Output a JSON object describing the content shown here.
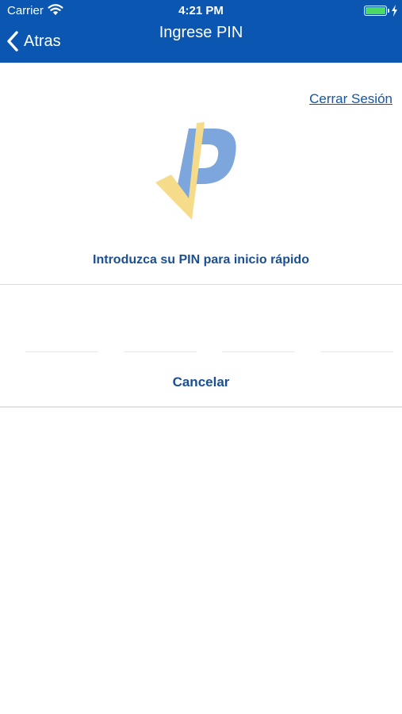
{
  "status_bar": {
    "carrier": "Carrier",
    "time": "4:21 PM"
  },
  "nav": {
    "back_label": "Atras",
    "title": "Ingrese PIN"
  },
  "logout_link": "Cerrar Sesión",
  "prompt": "Introduzca su PIN para inicio rápido",
  "pin": {
    "digits": [
      "",
      "",
      "",
      ""
    ]
  },
  "cancel_label": "Cancelar",
  "colors": {
    "header": "#0b56b0",
    "accent_text": "#1b4f93",
    "logo_blue": "#7da6dc",
    "logo_yellow": "#f6dc8a",
    "battery": "#4cd964"
  },
  "icons": {
    "back": "chevron-left-icon",
    "wifi": "wifi-icon",
    "battery": "battery-icon",
    "charging": "bolt-icon"
  }
}
